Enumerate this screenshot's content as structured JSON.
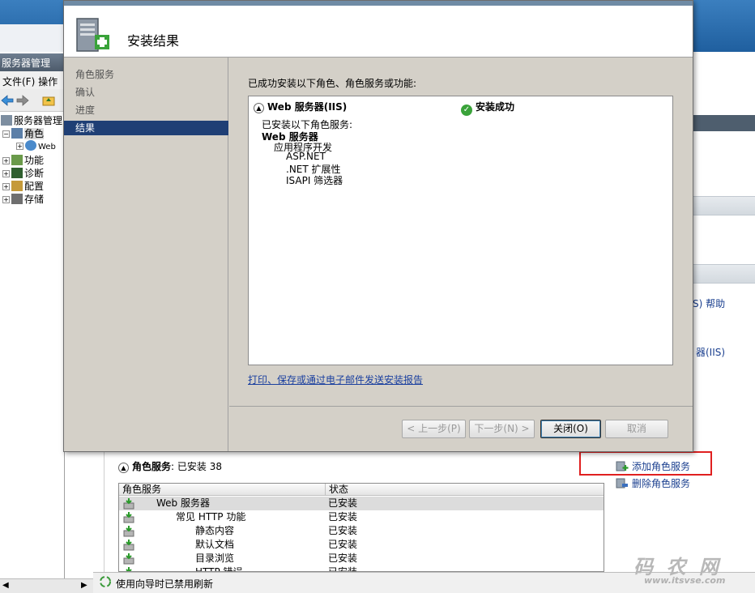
{
  "background": {
    "title": "服务器管理",
    "menu": "文件(F)   操作",
    "tree": [
      {
        "label": "服务器管理",
        "indent": 0
      },
      {
        "label": "角色",
        "indent": 1
      },
      {
        "label": "Web",
        "indent": 2
      },
      {
        "label": "功能",
        "indent": 1
      },
      {
        "label": "诊断",
        "indent": 1
      },
      {
        "label": "配置",
        "indent": 1
      },
      {
        "label": "存储",
        "indent": 1
      }
    ],
    "right_links": [
      "S) 帮助",
      "器(IIS)"
    ],
    "status_text": "使用向导时已禁用刷新"
  },
  "lower": {
    "roles_header_label": "角色服务",
    "roles_header_status": ": 已安装 38",
    "table_headers": [
      "角色服务",
      "状态"
    ],
    "rows": [
      {
        "name": "Web 服务器",
        "status": "已安装"
      },
      {
        "name": "常见 HTTP 功能",
        "status": "已安装"
      },
      {
        "name": "静态内容",
        "status": "已安装"
      },
      {
        "name": "默认文档",
        "status": "已安装"
      },
      {
        "name": "目录浏览",
        "status": "已安装"
      },
      {
        "name": "HTTP 错误",
        "status": "已安装"
      }
    ],
    "actions": [
      "添加角色服务",
      "删除角色服务"
    ]
  },
  "wizard": {
    "header_title": "安装结果",
    "steps": [
      "角色服务",
      "确认",
      "进度",
      "结果"
    ],
    "active_step": 3,
    "intro": "已成功安装以下角色、角色服务或功能:",
    "result_head": "Web 服务器(IIS)",
    "result_status": "安装成功",
    "result_lines": [
      {
        "text": "已安装以下角色服务:",
        "bold": false
      },
      {
        "text": "Web 服务器",
        "bold": true
      },
      {
        "text": "应用程序开发",
        "bold": false
      },
      {
        "text": "ASP.NET",
        "bold": false
      },
      {
        "text": ".NET 扩展性",
        "bold": false
      },
      {
        "text": "ISAPI 筛选器",
        "bold": false
      }
    ],
    "report_link": "打印、保存或通过电子邮件发送安装报告",
    "buttons": {
      "prev": "< 上一步(P)",
      "next": "下一步(N) >",
      "close": "关闭(O)",
      "cancel": "取消"
    }
  },
  "watermark": {
    "text": "码 农 网",
    "url": "www.itsvse.com"
  },
  "colors": {
    "active_step": "#1f3f75",
    "link": "#1a3f9f",
    "highlight": "#e02020",
    "success": "#3aa33a"
  }
}
